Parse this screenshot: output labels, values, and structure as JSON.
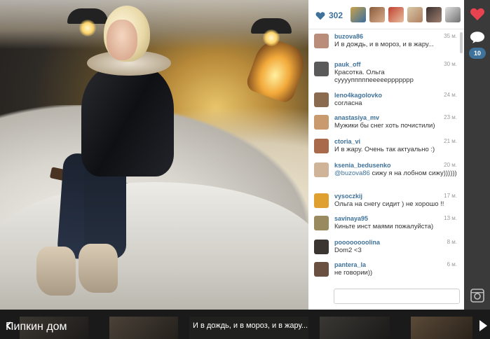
{
  "likes": {
    "count": "302"
  },
  "comments": [
    {
      "user": "buzova86",
      "time": "35 м.",
      "text": "И в дождь, и в мороз, и в жару...",
      "mention": "",
      "avatar_color": "#b98d7a"
    },
    {
      "user": "pauk_off",
      "time": "30 м.",
      "text": "Красотка. Ольга суууупппппеееееррррррр",
      "mention": "",
      "avatar_color": "#5a5a5a"
    },
    {
      "user": "leno4kagolovko",
      "time": "24 м.",
      "text": "согласна",
      "mention": "",
      "avatar_color": "#8a6b50"
    },
    {
      "user": "anastasiya_mv",
      "time": "23 м.",
      "text": "Мужики бы снег хоть почистили)",
      "mention": "",
      "avatar_color": "#c99a6e"
    },
    {
      "user": "ctoria_vi",
      "time": "21 м.",
      "text": "И в жару. Очень так актуально :)",
      "mention": "",
      "avatar_color": "#a86a4a"
    },
    {
      "user": "ksenia_bedusenko",
      "time": "20 м.",
      "text": " сижу я на лобном сижу))))))",
      "mention": "@buzova86",
      "avatar_color": "#d0b49a"
    },
    {
      "user": "vysoczkij",
      "time": "17 м.",
      "text": "Ольга на снегу сидит ) не хорошо !!",
      "mention": "",
      "avatar_color": "#e0a030"
    },
    {
      "user": "savinaya95",
      "time": "13 м.",
      "text": "Киньте инст маями пожалуйста)",
      "mention": "",
      "avatar_color": "#9a8a60"
    },
    {
      "user": "poooooooolina",
      "time": "8 м.",
      "text": "Dom2 <3",
      "mention": "",
      "avatar_color": "#3a3530"
    },
    {
      "user": "pantera_la",
      "time": "6 м.",
      "text": "не говории))",
      "mention": "",
      "avatar_color": "#6a5040"
    }
  ],
  "actions": {
    "comment_badge": "10"
  },
  "strip": {
    "title": "Пипкин дом",
    "caption": "И в дождь, и в мороз, и в жару..."
  },
  "colors": {
    "link": "#3f729b",
    "heart": "#e8434f",
    "panel": "#ffffff",
    "sidebar": "#3a3a3a"
  },
  "icons": [
    "heart-icon",
    "comment-icon",
    "camera-icon",
    "arrow-left-icon",
    "arrow-right-icon"
  ]
}
